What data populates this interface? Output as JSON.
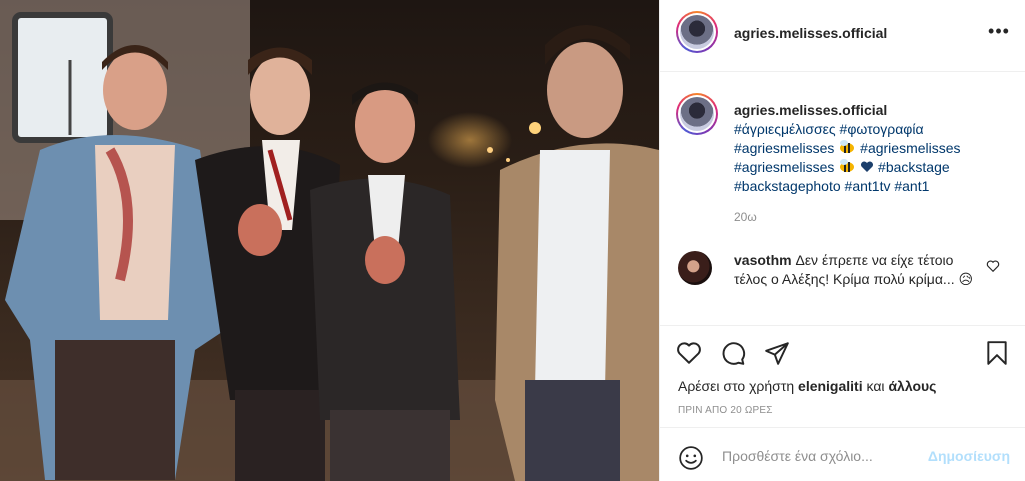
{
  "post": {
    "username": "agries.melisses.official",
    "more_icon": "more-horizontal-icon",
    "caption": {
      "username": "agries.melisses.official",
      "line1": [
        "#άγριεςμέλισσες",
        "#φωτογραφία"
      ],
      "line2": [
        "#agriesmelisses",
        "#agriesmelisses"
      ],
      "line3": [
        "#agriesmelisses",
        "#backstage"
      ],
      "line4": [
        "#backstagephoto",
        "#ant1tv",
        "#ant1"
      ],
      "time": "20ω"
    },
    "comment": {
      "username": "vasothm",
      "text": "Δεν έπρεπε να είχε τέτοιο τέλος ο Αλέξης! Κρίμα πολύ κρίμα...",
      "emoji": "😥"
    },
    "actions": {
      "like_icon": "heart-icon",
      "comment_icon": "comment-icon",
      "share_icon": "share-icon",
      "save_icon": "bookmark-icon"
    },
    "likes": {
      "prefix": "Αρέσει στο χρήστη",
      "user": "elenigaliti",
      "and": "και",
      "others": "άλλους"
    },
    "timestamp": "ΠΡΙΝ ΑΠΟ 20 ΩΡΕΣ",
    "add_comment": {
      "placeholder": "Προσθέστε ένα σχόλιο...",
      "post_label": "Δημοσίευση"
    }
  },
  "colors": {
    "link": "#00376b",
    "muted": "#8e8e8e",
    "post_disabled": "#b2dffc",
    "border": "#efefef"
  }
}
